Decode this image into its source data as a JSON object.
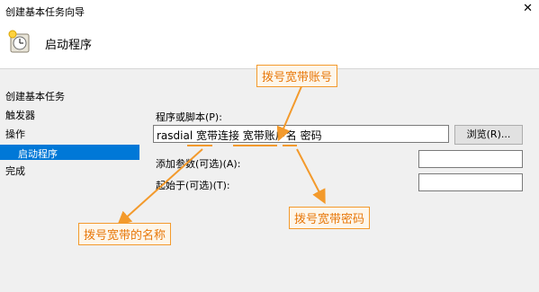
{
  "window": {
    "title": "创建基本任务向导",
    "close_glyph": "✕"
  },
  "header": {
    "title": "启动程序",
    "icon": "clock-icon"
  },
  "sidebar": {
    "items": [
      {
        "label": "创建基本任务"
      },
      {
        "label": "触发器"
      },
      {
        "label": "操作"
      },
      {
        "label": "启动程序"
      },
      {
        "label": "完成"
      }
    ],
    "active_index": 3
  },
  "form": {
    "program_label": "程序或脚本(P):",
    "program_value": "rasdial 宽带连接 宽带账户名 密码",
    "browse_label": "浏览(R)...",
    "args_label": "添加参数(可选)(A):",
    "args_value": "",
    "start_in_label": "起始于(可选)(T):",
    "start_in_value": ""
  },
  "annotations": {
    "account": "拨号宽带账号",
    "name": "拨号宽带的名称",
    "password": "拨号宽带密码"
  },
  "colors": {
    "accent": "#0078d7",
    "annotation": "#f39a2c"
  }
}
